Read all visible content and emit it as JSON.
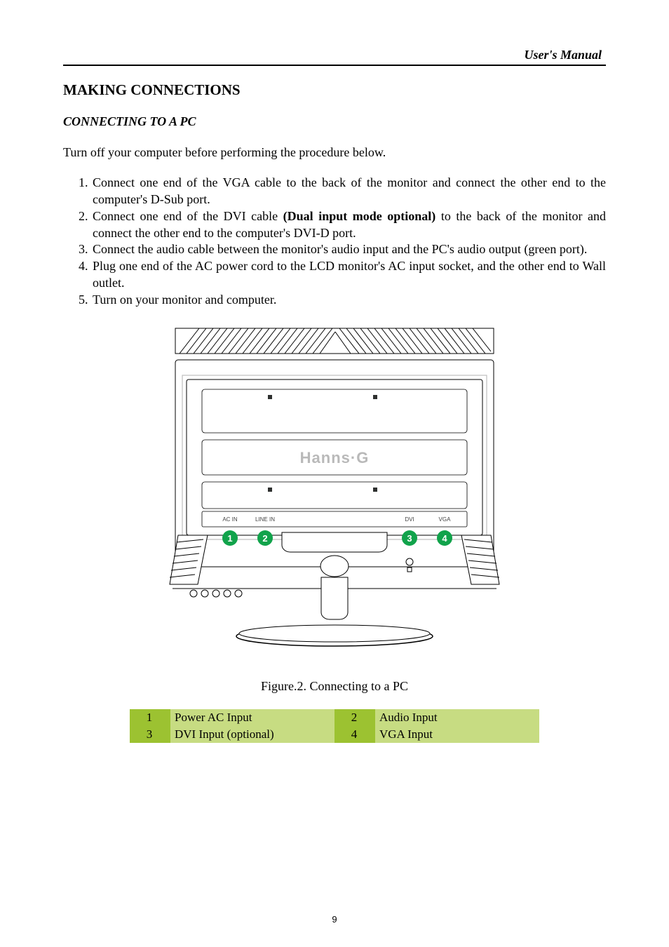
{
  "header": "User's Manual",
  "h1": "MAKING CONNECTIONS",
  "h2": "CONNECTING TO A PC",
  "intro": "Turn off your computer before performing the procedure below.",
  "steps": [
    {
      "pre": "Connect one end of the VGA cable to the back of the monitor and connect the other end to the computer's D-Sub port."
    },
    {
      "pre": "Connect one end of the DVI cable ",
      "bold": "(Dual input mode optional)",
      "post": " to the back of the monitor and connect the other end to the computer's DVI-D port."
    },
    {
      "pre": "Connect the audio cable between the monitor's audio input and the PC's audio output (green port)."
    },
    {
      "pre": "Plug one end of the AC power cord to the LCD monitor's AC input socket, and the other end to Wall outlet."
    },
    {
      "pre": "Turn on your monitor and computer."
    }
  ],
  "diagram": {
    "brand": "Hanns·G",
    "port_labels": {
      "ac": "AC IN",
      "line": "LINE IN",
      "dvi": "DVI",
      "vga": "VGA"
    },
    "callouts": [
      "1",
      "2",
      "3",
      "4"
    ]
  },
  "caption": "Figure.2. Connecting to a PC",
  "table": {
    "r1": {
      "n1": "1",
      "l1": "Power AC Input",
      "n2": "2",
      "l2": "Audio Input"
    },
    "r2": {
      "n1": "3",
      "l1": "DVI Input (optional)",
      "n2": "4",
      "l2": "VGA Input"
    }
  },
  "page_number": "9"
}
